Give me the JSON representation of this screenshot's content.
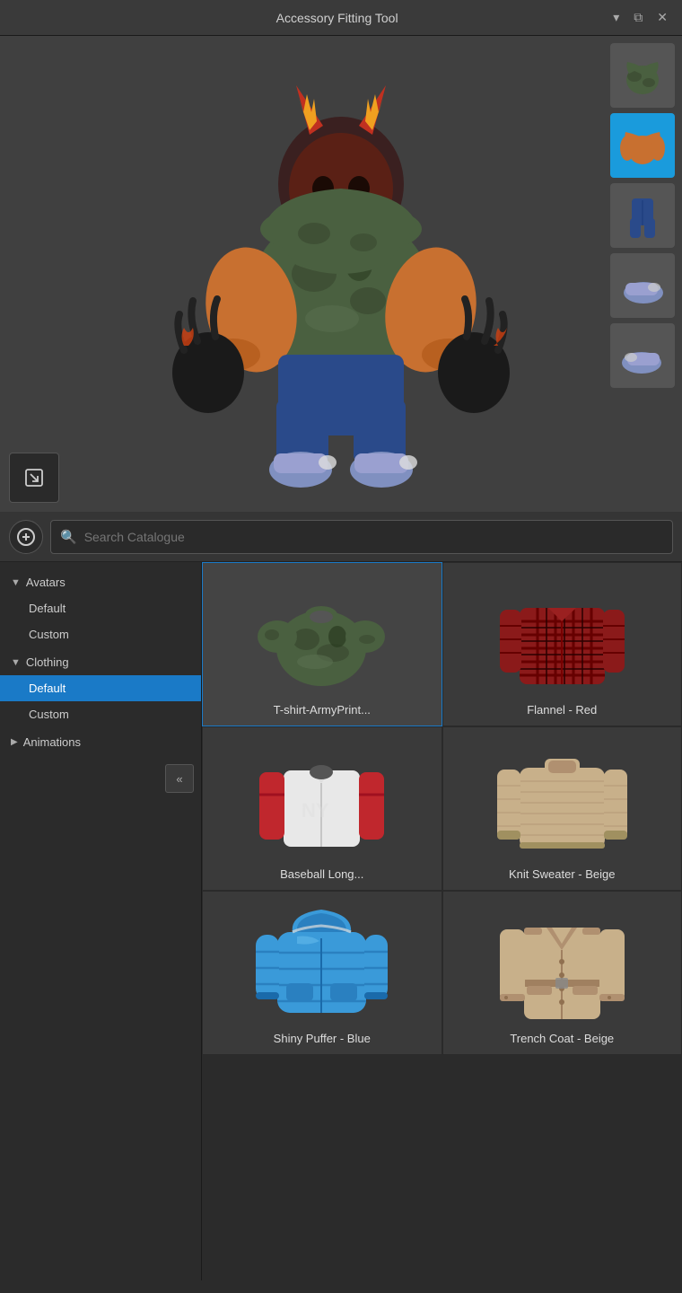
{
  "window": {
    "title": "Accessory Fitting Tool",
    "controls": [
      "▾",
      "⧉",
      "✕"
    ]
  },
  "search": {
    "placeholder": "Search Catalogue",
    "add_label": "⊕"
  },
  "sidebar": {
    "sections": [
      {
        "name": "Avatars",
        "expanded": true,
        "items": [
          "Default",
          "Custom"
        ]
      },
      {
        "name": "Clothing",
        "expanded": true,
        "items": [
          "Default",
          "Custom"
        ]
      },
      {
        "name": "Animations",
        "expanded": false,
        "items": []
      }
    ],
    "active_section": "Clothing",
    "active_item": "Default"
  },
  "grid_items": [
    {
      "label": "T-shirt-ArmyPrint...",
      "color_main": "#4a6040",
      "color_accent": "#333",
      "type": "tshirt_camo",
      "selected": true
    },
    {
      "label": "Flannel - Red",
      "color_main": "#8b1a1a",
      "color_accent": "#222",
      "type": "flannel_red"
    },
    {
      "label": "Baseball Long...",
      "color_main": "#e0e0e0",
      "color_accent": "#c0272d",
      "type": "baseball_long"
    },
    {
      "label": "Knit Sweater - Beige",
      "color_main": "#c8b08a",
      "color_accent": "#b09070",
      "type": "knit_beige"
    },
    {
      "label": "Shiny Puffer - Blue",
      "color_main": "#3a9ad9",
      "color_accent": "#1a6aaa",
      "type": "puffer_blue"
    },
    {
      "label": "Trench Coat - Beige",
      "color_main": "#c8b08a",
      "color_accent": "#a09070",
      "type": "trench_beige"
    }
  ],
  "side_thumbs": [
    {
      "label": "camo-shirt",
      "active": false
    },
    {
      "label": "orange-sweater",
      "active": true
    },
    {
      "label": "jeans",
      "active": false
    },
    {
      "label": "shoe-left",
      "active": false
    },
    {
      "label": "shoe-right",
      "active": false
    }
  ],
  "collapse_btn_label": "«"
}
